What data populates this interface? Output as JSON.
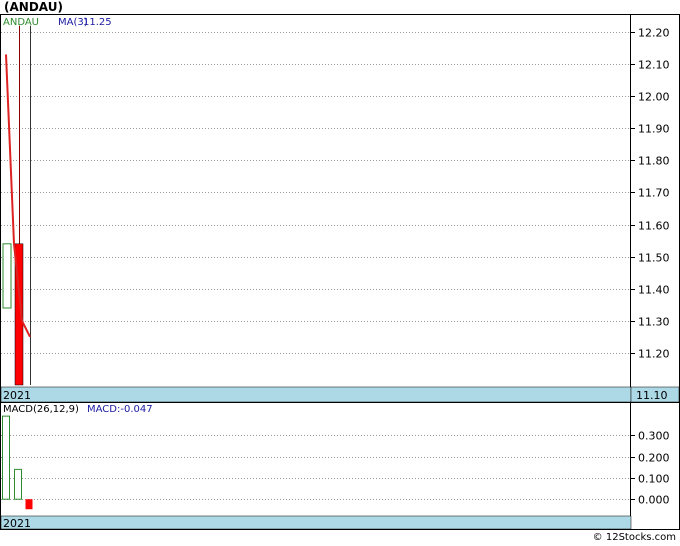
{
  "title": "(ANDAU)",
  "copyright": "© 12Stocks.com",
  "colors": {
    "up": "#2e8b2e",
    "down": "#ff0000",
    "ma_line": "#dd2222",
    "axis_band": "#add8e6",
    "grid": "#999999",
    "legend_ticker": "#2e8b2e",
    "legend_ma": "#1a1aa0",
    "legend_macd": "#1a1aa0"
  },
  "chart_data": [
    {
      "type": "candlestick",
      "ticker_label": "ANDAU",
      "ma_label": "MA(3)",
      "ma_value": "11.25",
      "year_label": "2021",
      "ylim": [
        11.1,
        12.2
      ],
      "y_ticks": [
        "12.20",
        "12.10",
        "12.00",
        "11.90",
        "11.80",
        "11.70",
        "11.60",
        "11.50",
        "11.40",
        "11.30",
        "11.20",
        "11.10"
      ],
      "candles": [
        {
          "open": 11.34,
          "close": 11.54,
          "high": 11.54,
          "low": 11.34,
          "dir": "up",
          "wick_top": false
        },
        {
          "open": 11.54,
          "close": 11.1,
          "high": 12.22,
          "low": 11.1,
          "dir": "down",
          "wick_top": true
        },
        {
          "open": 11.1,
          "close": 11.1,
          "high": 12.22,
          "low": 11.1,
          "dir": "flat",
          "wick_top": true
        }
      ],
      "ma_points": [
        12.13,
        11.54,
        11.3,
        11.25
      ]
    },
    {
      "type": "bar",
      "label": "MACD(26,12,9)",
      "value_label": "MACD:-0.047",
      "year_label": "2021",
      "ylim": [
        -0.06,
        0.4
      ],
      "y_ticks": [
        "0.300",
        "0.200",
        "0.100",
        "0.000"
      ],
      "bars": [
        {
          "value": 0.39,
          "dir": "up"
        },
        {
          "value": 0.14,
          "dir": "up"
        },
        {
          "value": -0.047,
          "dir": "down"
        }
      ]
    }
  ]
}
